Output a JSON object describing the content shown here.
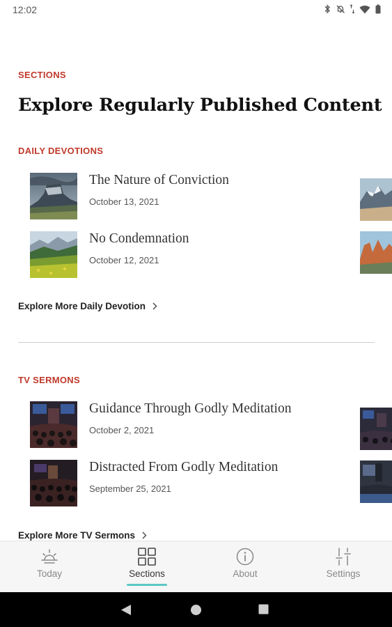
{
  "status_bar": {
    "time": "12:02"
  },
  "section_eyebrow": "SECTIONS",
  "page_title": "Explore Regularly Published Content",
  "daily": {
    "heading": "DAILY DEVOTIONS",
    "items": [
      {
        "title": "The Nature of Conviction",
        "date": "October 13, 2021"
      },
      {
        "title": "No Condemnation",
        "date": "October 12, 2021"
      }
    ],
    "explore_label": "Explore More Daily Devotion"
  },
  "tv": {
    "heading": "TV SERMONS",
    "items": [
      {
        "title": "Guidance Through Godly Meditation",
        "date": "October 2, 2021"
      },
      {
        "title": "Distracted From Godly Meditation",
        "date": "September 25, 2021"
      }
    ],
    "explore_label": "Explore More TV Sermons"
  },
  "tabs": [
    {
      "label": "Today",
      "icon": "sunrise-icon",
      "active": false
    },
    {
      "label": "Sections",
      "icon": "grid-icon",
      "active": true
    },
    {
      "label": "About",
      "icon": "info-icon",
      "active": false
    },
    {
      "label": "Settings",
      "icon": "sliders-icon",
      "active": false
    }
  ],
  "colors": {
    "accent": "#c0392b",
    "tab_indicator": "#5cc6c4"
  }
}
